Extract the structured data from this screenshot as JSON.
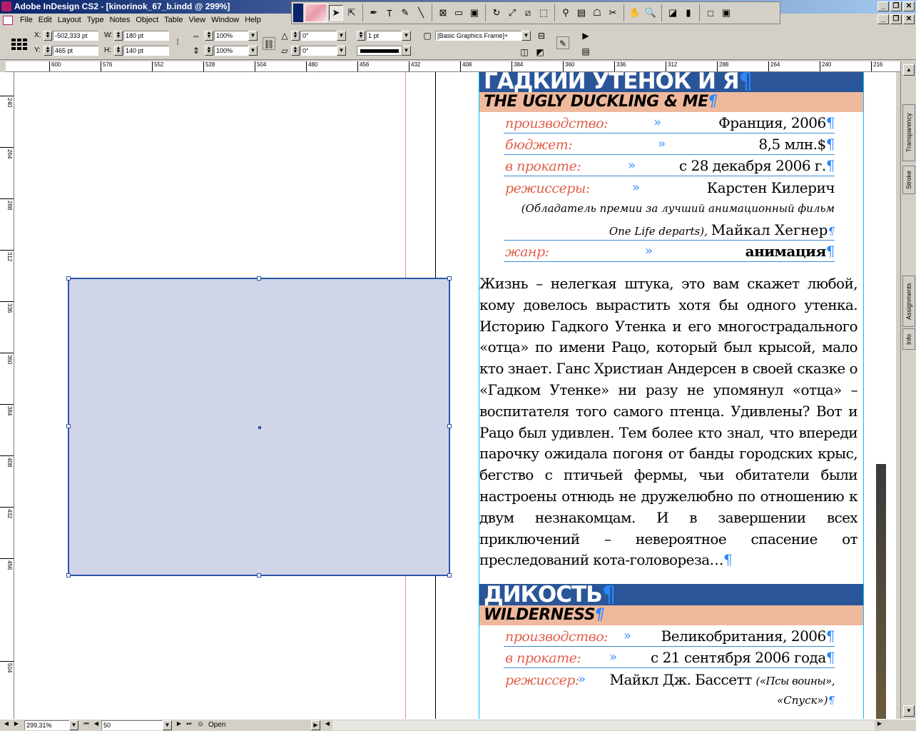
{
  "window": {
    "title": "Adobe InDesign CS2 - [kinorinok_67_b.indd @ 299%]",
    "controls": {
      "minimize": "_",
      "restore": "❐",
      "close": "✕"
    }
  },
  "menu": [
    "File",
    "Edit",
    "Layout",
    "Type",
    "Notes",
    "Object",
    "Table",
    "View",
    "Window",
    "Help"
  ],
  "control": {
    "x_label": "X:",
    "x_value": "-502,333 pt",
    "y_label": "Y:",
    "y_value": "465 pt",
    "w_label": "W:",
    "w_value": "180 pt",
    "h_label": "H:",
    "h_value": "140 pt",
    "scale_x": "100%",
    "scale_y": "100%",
    "rotate": "0°",
    "shear": "0°",
    "stroke_weight": "1 pt",
    "object_style": "[Basic Graphics Frame]+"
  },
  "ruler_h": [
    "600",
    "576",
    "552",
    "528",
    "504",
    "480",
    "456",
    "432",
    "408",
    "384",
    "360",
    "336",
    "312",
    "288",
    "264",
    "240",
    "216"
  ],
  "ruler_v": [
    "240",
    "264",
    "288",
    "312",
    "336",
    "360",
    "384",
    "408",
    "432",
    "456",
    "504"
  ],
  "article1": {
    "title": "ГАДКИЙ УТЕНОК И Я",
    "subtitle": "THE UGLY DUCKLING & ME",
    "rows": [
      {
        "label": "производство:",
        "value": "Франция, 2006"
      },
      {
        "label": "бюджет:",
        "value": "8,5 млн.$"
      },
      {
        "label": "в прокате:",
        "value": "с 28 декабря 2006 г."
      },
      {
        "label": "режиссеры:",
        "value": "Карстен Килерич"
      }
    ],
    "note1": "(Обладатель премии за лучший анимационный фильм",
    "note2_italic": "One Life departs),",
    "note2_name": "Майкал Хегнер",
    "genre_label": "жанр:",
    "genre_value": "анимация",
    "body": "Жизнь – нелегкая штука, это вам скажет любой, кому довелось вырастить хотя бы одного утенка. Историю Гадкого Утенка и его многострадального «отца» по имени Рацо, который был крысой, мало кто знает. Ганс Христиан Андерсен в своей сказке о «Гадком Утенке» ни разу не упомянул «отца» – воспитателя того самого птенца. Удивлены? Вот и Рацо был удивлен. Тем более кто знал, что впереди парочку ожидала погоня от банды городских крыс, бегство с птичьей фермы, чьи обитатели были настроены отнюдь не дружелюбно по отношению к двум незнакомцам. И в завершении всех приключений – невероятное спасение от преследований кота-головореза…"
  },
  "article2": {
    "title": "ДИКОСТЬ",
    "subtitle": "WILDERNESS",
    "rows": [
      {
        "label": "производство:",
        "value": "Великобритания, 2006"
      },
      {
        "label": "в прокате:",
        "value": "с 21 сентября 2006 года"
      }
    ],
    "director_label": "режиссер:",
    "director_value": "Майкл Дж. Бассетт",
    "director_note": "(«Псы воины»,",
    "director_note2": "«Спуск»)"
  },
  "pilcrow": "¶",
  "raquo": "»",
  "palette_tabs": [
    "Transparency",
    "Stroke",
    "Assignments",
    "Info"
  ],
  "status": {
    "zoom": "299,31%",
    "page": "50",
    "state": "Open"
  },
  "colors": {
    "title_blue": "#2a5599",
    "subtitle_peach": "#efb99d",
    "label_red": "#e0604a",
    "frame_fill": "#d1d5e8",
    "selection_blue": "#2b56a8"
  }
}
